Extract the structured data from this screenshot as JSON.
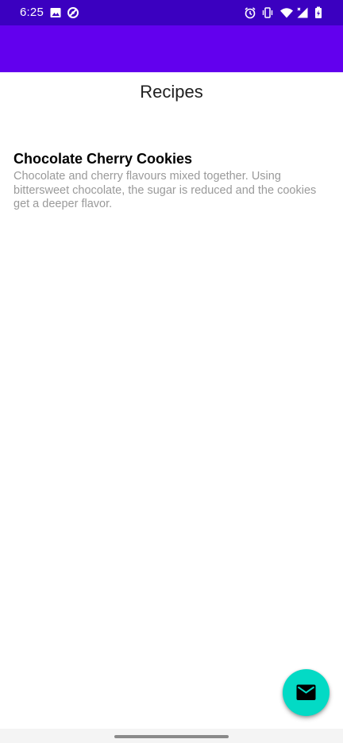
{
  "status_bar": {
    "time": "6:25",
    "color": "#3b00c0",
    "left_icons": [
      "image-icon",
      "data-saver-icon"
    ],
    "right_icons": [
      "alarm-icon",
      "vibrate-icon",
      "wifi-icon",
      "cellular-signal-icon",
      "battery-charging-icon"
    ]
  },
  "app_bar": {
    "color": "#6200ee"
  },
  "page": {
    "title": "Recipes"
  },
  "recipes": [
    {
      "name": "Chocolate Cherry Cookies",
      "description": "Chocolate and cherry flavours mixed together. Using bittersweet chocolate, the sugar is reduced and the cookies get a deeper flavor."
    }
  ],
  "fab": {
    "icon": "email-icon",
    "color": "#03dac5"
  },
  "navigation": {
    "type": "gesture-handle"
  }
}
